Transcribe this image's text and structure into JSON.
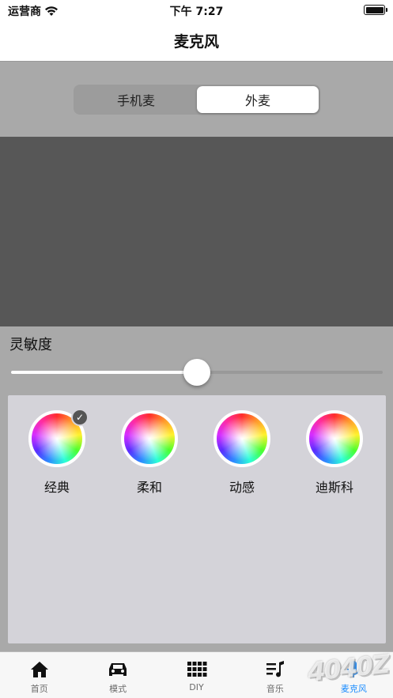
{
  "status_bar": {
    "carrier": "运营商",
    "time": "下午 7:27"
  },
  "nav": {
    "title": "麦克风"
  },
  "segments": [
    {
      "label": "手机麦",
      "active": false
    },
    {
      "label": "外麦",
      "active": true
    }
  ],
  "sensitivity": {
    "label": "灵敏度",
    "value": 0.5
  },
  "modes": [
    {
      "label": "经典",
      "selected": true
    },
    {
      "label": "柔和",
      "selected": false
    },
    {
      "label": "动感",
      "selected": false
    },
    {
      "label": "迪斯科",
      "selected": false
    }
  ],
  "tabs": [
    {
      "label": "首页",
      "icon": "home-icon",
      "active": false
    },
    {
      "label": "模式",
      "icon": "car-icon",
      "active": false
    },
    {
      "label": "DIY",
      "icon": "grid-icon",
      "active": false
    },
    {
      "label": "音乐",
      "icon": "music-icon",
      "active": false
    },
    {
      "label": "麦克风",
      "icon": "microphone-icon",
      "active": true
    }
  ],
  "watermark": {
    "text": "4040Z"
  },
  "colors": {
    "active_tab": "#1a8cff",
    "panel_dark": "#575757",
    "background": "#a9a9a9"
  }
}
